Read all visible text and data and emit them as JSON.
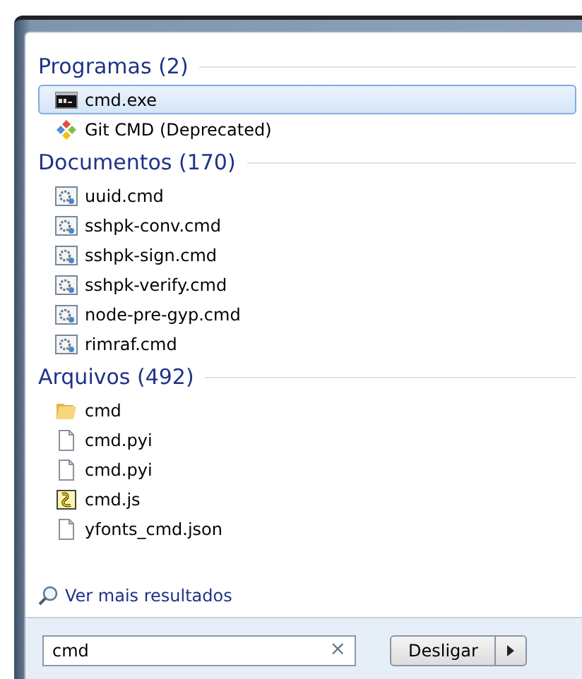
{
  "groups": [
    {
      "title": "Programas (2)",
      "items": [
        {
          "label": "cmd.exe",
          "kind": "console",
          "selected": true
        },
        {
          "label": "Git CMD (Deprecated)",
          "kind": "git",
          "selected": false
        }
      ]
    },
    {
      "title": "Documentos (170)",
      "items": [
        {
          "label": "uuid.cmd",
          "kind": "batch",
          "selected": false
        },
        {
          "label": "sshpk-conv.cmd",
          "kind": "batch",
          "selected": false
        },
        {
          "label": "sshpk-sign.cmd",
          "kind": "batch",
          "selected": false
        },
        {
          "label": "sshpk-verify.cmd",
          "kind": "batch",
          "selected": false
        },
        {
          "label": "node-pre-gyp.cmd",
          "kind": "batch",
          "selected": false
        },
        {
          "label": "rimraf.cmd",
          "kind": "batch",
          "selected": false
        }
      ]
    },
    {
      "title": "Arquivos (492)",
      "items": [
        {
          "label": "cmd",
          "kind": "folder",
          "selected": false
        },
        {
          "label": "cmd.pyi",
          "kind": "file",
          "selected": false
        },
        {
          "label": "cmd.pyi",
          "kind": "file",
          "selected": false
        },
        {
          "label": "cmd.js",
          "kind": "script",
          "selected": false
        },
        {
          "label": "yfonts_cmd.json",
          "kind": "file",
          "selected": false
        }
      ]
    }
  ],
  "more_results": "Ver mais resultados",
  "search": {
    "value": "cmd",
    "clear": "×"
  },
  "shutdown": {
    "label": "Desligar"
  }
}
